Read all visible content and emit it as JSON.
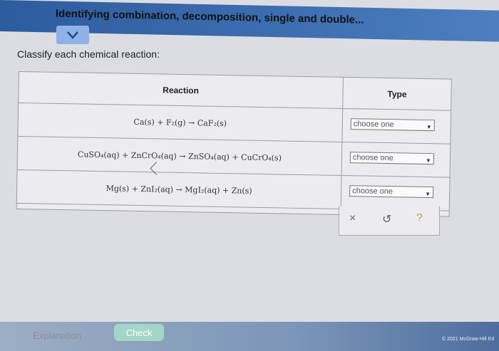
{
  "header": {
    "title": "Identifying combination, decomposition, single and double..."
  },
  "prompt": "Classify each chemical reaction:",
  "table": {
    "headers": {
      "reaction": "Reaction",
      "type": "Type"
    },
    "rows": [
      {
        "equation": "Ca(s) + F₂(g) → CaF₂(s)",
        "select_value": "choose one"
      },
      {
        "equation": "CuSO₄(aq) + ZnCrO₄(aq) → ZnSO₄(aq) + CuCrO₄(s)",
        "select_value": "choose one"
      },
      {
        "equation": "Mg(s) + ZnI₂(aq) → MgI₂(aq) + Zn(s)",
        "select_value": "choose one"
      }
    ]
  },
  "actions": {
    "clear": "×",
    "undo": "↺",
    "help": "?"
  },
  "footer": {
    "explanation": "Explanation",
    "check": "Check",
    "copyright": "© 2021 McGraw-Hill Ed"
  }
}
